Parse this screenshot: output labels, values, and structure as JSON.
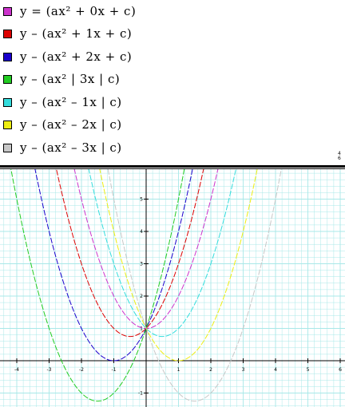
{
  "legend": {
    "corner_mark": "4\n6",
    "items": [
      {
        "label": "y = (ax² + 0x + c)",
        "color": "#cc33cc"
      },
      {
        "label": "y – (ax² + 1x + c)",
        "color": "#dd0000"
      },
      {
        "label": "y – (ax² + 2x + c)",
        "color": "#1a00cc"
      },
      {
        "label": "y – (ax² | 3x | c)",
        "color": "#22cc22"
      },
      {
        "label": "y – (ax² – 1x | c)",
        "color": "#33dddd"
      },
      {
        "label": "y – (ax² – 2x | c)",
        "color": "#eeee11"
      },
      {
        "label": "y – (ax² – 3x | c)",
        "color": "#c8c8c8"
      }
    ]
  },
  "chart_data": {
    "type": "line",
    "title": "",
    "xlabel": "",
    "ylabel": "",
    "xlim": [
      -4.5,
      6.2
    ],
    "ylim": [
      -1.45,
      5.2
    ],
    "grid": true,
    "grid_color": "#a8e8e8",
    "x_tick_labels": [
      "-4",
      "-3",
      "-2",
      "-1",
      "1",
      "2",
      "3",
      "4",
      "5",
      "6"
    ],
    "y_tick_labels": [
      "-1",
      "1",
      "2",
      "3",
      "4",
      "5"
    ],
    "series": [
      {
        "a": 1,
        "b": 0,
        "c": 1,
        "color": "#cc33cc",
        "name": "y = (ax² + 0x + c)"
      },
      {
        "a": 1,
        "b": 1,
        "c": 1,
        "color": "#dd0000",
        "name": "y – (ax² + 1x + c)"
      },
      {
        "a": 1,
        "b": 2,
        "c": 1,
        "color": "#1a00cc",
        "name": "y – (ax² + 2x + c)"
      },
      {
        "a": 1,
        "b": 3,
        "c": 1,
        "color": "#22cc22",
        "name": "y – (ax² | 3x | c)"
      },
      {
        "a": 1,
        "b": -1,
        "c": 1,
        "color": "#33dddd",
        "name": "y – (ax² – 1x | c)"
      },
      {
        "a": 1,
        "b": -2,
        "c": 1,
        "color": "#eeee11",
        "name": "y – (ax² – 2x | c)"
      },
      {
        "a": 1,
        "b": -3,
        "c": 1,
        "color": "#c8c8c8",
        "name": "y – (ax² – 3x | c)"
      }
    ]
  }
}
